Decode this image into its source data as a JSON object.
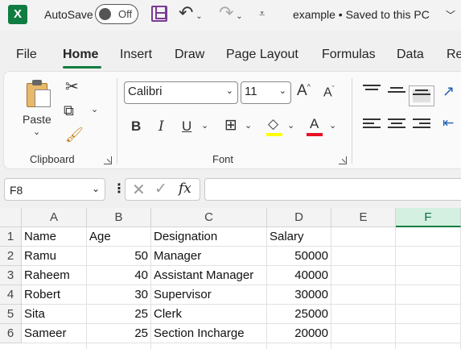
{
  "titlebar": {
    "app_icon": "X",
    "autosave_label": "AutoSave",
    "autosave_state": "Off",
    "doc_title": "example • Saved to this PC",
    "icons": [
      "excel-logo-icon",
      "save-icon",
      "undo-icon",
      "redo-icon",
      "customize-qat-icon",
      "chevron-down-icon"
    ]
  },
  "menu": {
    "tabs": [
      "File",
      "Home",
      "Insert",
      "Draw",
      "Page Layout",
      "Formulas",
      "Data",
      "Re"
    ],
    "active": "Home"
  },
  "ribbon": {
    "clipboard": {
      "label": "Clipboard",
      "paste_label": "Paste"
    },
    "font": {
      "label": "Font",
      "font_name": "Calibri",
      "font_size": "11",
      "bold": "B",
      "italic": "I",
      "underline": "U"
    },
    "colors": {
      "accent": "#107c41",
      "highlight": "#ffff00",
      "font_color": "#e81123"
    }
  },
  "formula_bar": {
    "name_box": "F8",
    "fx": "fx",
    "value": ""
  },
  "grid": {
    "columns": [
      "A",
      "B",
      "C",
      "D",
      "E",
      "F"
    ],
    "selected_column": "F",
    "rows": [
      "1",
      "2",
      "3",
      "4",
      "5",
      "6"
    ],
    "cells": [
      [
        "Name",
        "Age",
        "Designation",
        "Salary"
      ],
      [
        "Ramu",
        "50",
        "Manager",
        "50000"
      ],
      [
        "Raheem",
        "40",
        "Assistant Manager",
        "40000"
      ],
      [
        "Robert",
        "30",
        "Supervisor",
        "30000"
      ],
      [
        "Sita",
        "25",
        "Clerk",
        "25000"
      ],
      [
        "Sameer",
        "25",
        "Section Incharge",
        "20000"
      ]
    ]
  }
}
